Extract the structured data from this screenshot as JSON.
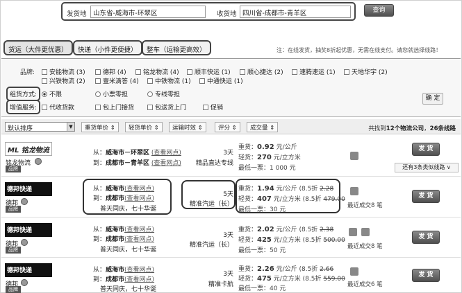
{
  "search": {
    "from_label": "发货地",
    "from_value": "山东省-威海市-环翠区",
    "to_label": "收货地",
    "to_value": "四川省-成都市-青羊区",
    "query_label": "查询"
  },
  "tabs": [
    {
      "label": "货运（大件更优惠）"
    },
    {
      "label": "快递（小件更便捷）"
    },
    {
      "label": "整车（运输更高效）"
    }
  ],
  "note": "注：在线发货，抽奖8折起优惠，无需在线支付。请您就选择线路！",
  "filters": {
    "brand_label": "品牌:",
    "brands_row1": [
      "安能物流 (3)",
      "德邦 (4)",
      "铭龙物流 (4)",
      "顺丰快运 (1)",
      "顺心捷达 (2)",
      "速腾速运 (1)",
      "天地华宇 (2)"
    ],
    "brands_row2": [
      "兴铁物流 (2)",
      "壹米滴答 (4)",
      "中铁物流 (1)",
      "中通快运 (1)"
    ],
    "mode_label": "组货方式:",
    "modes": [
      "不限",
      "小票零担",
      "专线零担"
    ],
    "service_label": "增值服务:",
    "services": [
      "代收货款",
      "包上门接货",
      "包送货上门",
      "促销"
    ],
    "confirm_label": "确 定"
  },
  "sortbar": {
    "sort_default": "默认排序",
    "buttons": [
      "重货单价 ⇕",
      "轻货单价 ⇕",
      "运输时效 ⇕",
      "评分 ⇕",
      "成交量 ⇕"
    ],
    "count_text_pre": "共找到",
    "count_companies": "12个物流公司",
    "count_mid": "，",
    "count_routes": "26条线路"
  },
  "rows": [
    {
      "logo": "ML 铭龙物流",
      "company": "铭龙物流",
      "badge": "品牌",
      "from_prefix": "从：",
      "from_city": "威海市－环翠区",
      "to_prefix": "到：",
      "to_city": "成都市－青羊区",
      "outlet_link": "(查看网点)",
      "extra": "",
      "days": "3天",
      "service": "精品直达专线",
      "heavy_label": "重货：",
      "heavy_price": "0.92",
      "heavy_unit": "元/公斤",
      "heavy_discount": "",
      "heavy_orig": "",
      "light_label": "轻货：",
      "light_price": "270",
      "light_unit": "元/立方米",
      "light_discount": "",
      "light_orig": "",
      "min_label": "最低一票：",
      "min_value": "1 000 元",
      "recent": "",
      "ship_label": "发 货",
      "more_label": "还有3条类似线路 ∨"
    },
    {
      "logo": "德邦快递",
      "company": "德邦",
      "badge": "品牌",
      "from_prefix": "从：",
      "from_city": "威海市",
      "to_prefix": "到：",
      "to_city": "成都市",
      "outlet_link": "(查看网点)",
      "extra": "普天同庆，七十华诞",
      "days": "5天",
      "service": "精准汽运（长）",
      "heavy_label": "重货：",
      "heavy_price": "1.94",
      "heavy_unit": "元/公斤 (8.5折",
      "heavy_discount": "",
      "heavy_orig": "2.28",
      "light_label": "轻货：",
      "light_price": "407",
      "light_unit": "元/立方米 (8.5折",
      "light_discount": "",
      "light_orig": "479.00",
      "min_label": "最低一票：",
      "min_value": "30 元",
      "recent": "最近成交8 笔",
      "ship_label": "发 货",
      "more_label": ""
    },
    {
      "logo": "德邦快递",
      "company": "德邦",
      "badge": "品牌",
      "from_prefix": "从：",
      "from_city": "威海市",
      "to_prefix": "到：",
      "to_city": "成都市",
      "outlet_link": "(查看网点)",
      "extra": "普天同庆，七十华诞",
      "days": "3天",
      "service": "精准汽运（长）",
      "heavy_label": "重货：",
      "heavy_price": "2.02",
      "heavy_unit": "元/公斤 (8.5折",
      "heavy_discount": "",
      "heavy_orig": "2.38",
      "light_label": "轻货：",
      "light_price": "425",
      "light_unit": "元/立方米 (8.5折",
      "light_discount": "",
      "light_orig": "500.00",
      "min_label": "最低一票：",
      "min_value": "50 元",
      "recent": "最近成交8 笔",
      "ship_label": "发 货",
      "more_label": ""
    },
    {
      "logo": "德邦快递",
      "company": "德邦",
      "badge": "品牌",
      "from_prefix": "从：",
      "from_city": "威海市",
      "to_prefix": "到：",
      "to_city": "成都市",
      "outlet_link": "(查看网点)",
      "extra": "普天同庆，七十华诞",
      "days": "3天",
      "service": "精准卡航",
      "heavy_label": "重货：",
      "heavy_price": "2.26",
      "heavy_unit": "元/公斤 (8.5折",
      "heavy_discount": "",
      "heavy_orig": "2.66",
      "light_label": "轻货：",
      "light_price": "475",
      "light_unit": "元/立方米 (8.5折",
      "light_discount": "",
      "light_orig": "559.00",
      "min_label": "最低一票：",
      "min_value": "40 元",
      "recent": "最近成交6 笔",
      "ship_label": "发 货",
      "more_label": ""
    }
  ]
}
